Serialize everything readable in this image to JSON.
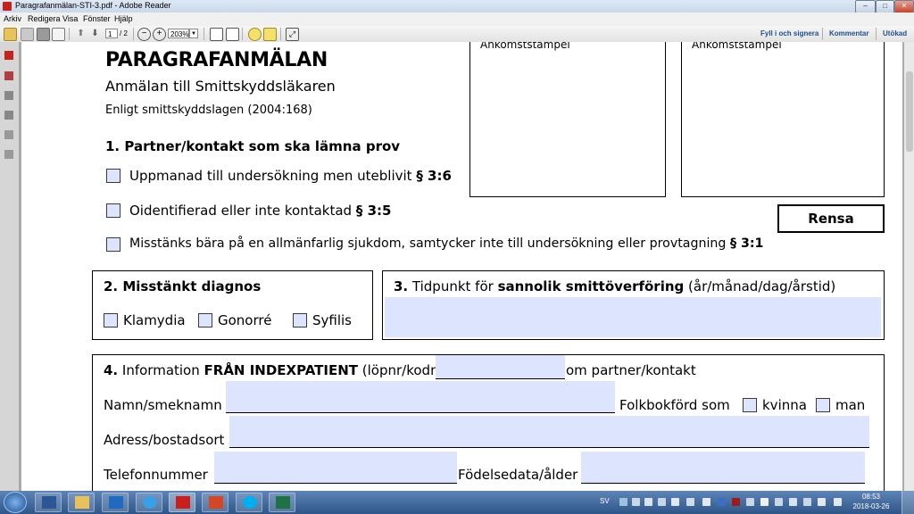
{
  "window": {
    "title": "Paragrafanmälan-STI-3.pdf - Adobe Reader",
    "buttons": [
      "–",
      "□",
      "✕"
    ]
  },
  "menu": [
    "Arkiv",
    "Redigera",
    "Visa",
    "Fönster",
    "Hjälp"
  ],
  "toolbar": {
    "page_current": "1",
    "page_total": "/ 2",
    "zoom": "203%",
    "links": [
      "Fyll i och signera",
      "Kommentar",
      "Utökad"
    ]
  },
  "doc": {
    "title": "PARAGRAFANMÄLAN",
    "subtitle": "Anmälan till Smittskyddsläkaren",
    "law": "Enligt smittskyddslagen (2004:168)",
    "stamp1": "Ankomststämpel",
    "stamp2": "Ankomststämpel",
    "reset": "Rensa",
    "s1": {
      "heading": "1. Partner/kontakt som ska lämna prov",
      "opt1": "Uppmanad till undersökning men uteblivit ",
      "opt1_ref": "§ 3:6",
      "opt2": "Oidentifierad eller inte kontaktad ",
      "opt2_ref": "§ 3:5",
      "opt3": "Misstänks bära på en allmänfarlig sjukdom, samtycker inte till undersökning eller provtagning ",
      "opt3_ref": "§ 3:1"
    },
    "s2": {
      "heading": "2. Misstänkt diagnos",
      "opts": [
        "Klamydia",
        "Gonorré",
        "Syfilis"
      ]
    },
    "s3": {
      "num": "3.",
      "pre": " Tidpunkt för ",
      "bold": "sannolik smittöverföring",
      "post": " (år/månad/dag/årstid)"
    },
    "s4": {
      "num": "4.",
      "pre": " Information ",
      "bold": "FRÅN INDEXPATIENT",
      "mid": " (löpnr/kodnr ",
      "post": " om partner/kontakt",
      "name_label": "Namn/smeknamn",
      "folk_label": "Folkbokförd som",
      "kvinna": "kvinna",
      "man": "man",
      "address_label": "Adress/bostadsort",
      "phone_label": "Telefonnummer",
      "birth_label": "Födelsedata/ålder"
    }
  },
  "tray": {
    "lang": "SV",
    "time": "08:53",
    "date": "2018-03-26"
  },
  "colors": {
    "field": "#dde4fd",
    "taskbar": "#2f5688",
    "pdf_red": "#c8201d"
  }
}
